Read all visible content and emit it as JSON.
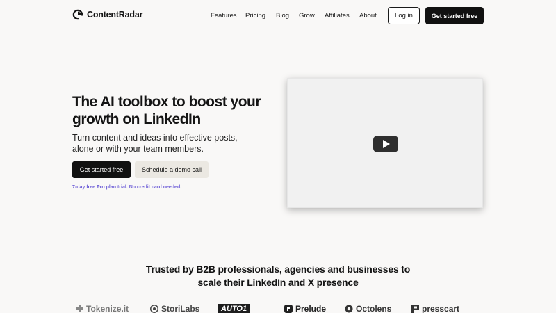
{
  "nav": {
    "brand": "ContentRadar",
    "links": [
      {
        "label": "Features"
      },
      {
        "label": "Pricing"
      },
      {
        "label": "Blog"
      },
      {
        "label": "Grow"
      },
      {
        "label": "Affiliates"
      },
      {
        "label": "About"
      }
    ],
    "login_label": "Log in",
    "cta_label": "Get started free"
  },
  "hero": {
    "title": "The AI toolbox to boost your growth on LinkedIn",
    "subtitle": "Turn content and ideas into effective posts, alone or with your team members.",
    "primary_label": "Get started free",
    "secondary_label": "Schedule a demo call",
    "trial_note": "7-day free Pro plan trial. No credit card needed."
  },
  "video": {
    "play_icon": "play-icon"
  },
  "trusted": {
    "title": "Trusted by B2B professionals, agencies and businesses to scale their LinkedIn and X presence",
    "logos": [
      {
        "name": "Tokenize.it"
      },
      {
        "name": "StoriLabs"
      },
      {
        "name": "AUTO1"
      },
      {
        "name": "Prelude"
      },
      {
        "name": "Octolens"
      },
      {
        "name": "presscart"
      }
    ]
  },
  "colors": {
    "background": "#f9f8f7",
    "primary": "#111111",
    "secondary_button": "#ebe8e2",
    "accent": "#6a5ad6"
  }
}
